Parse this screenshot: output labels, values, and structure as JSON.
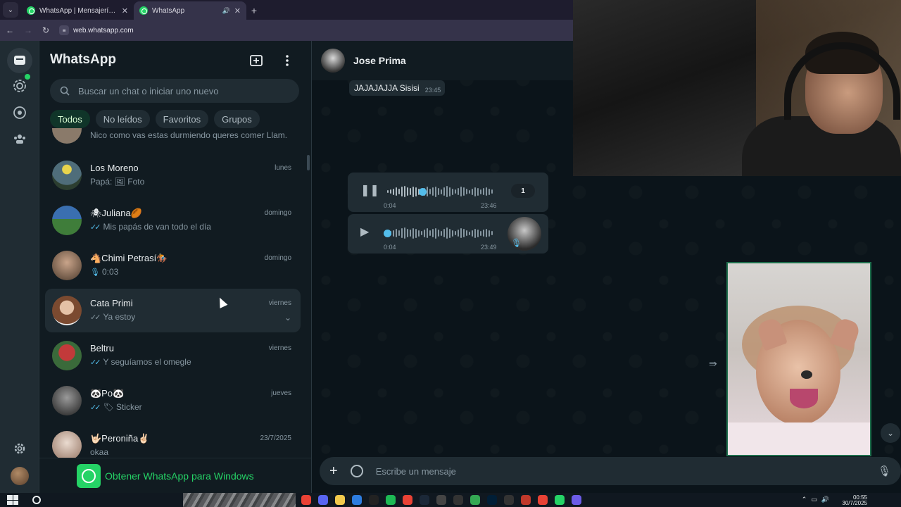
{
  "browser": {
    "tabs": [
      {
        "title": "WhatsApp | Mensajería y llamadas"
      },
      {
        "title": "WhatsApp"
      }
    ],
    "url": "web.whatsapp.com"
  },
  "sidebar": {
    "title": "WhatsApp",
    "search_placeholder": "Buscar un chat o iniciar uno nuevo",
    "filters": [
      "Todos",
      "No leídos",
      "Favoritos",
      "Grupos"
    ],
    "active_filter": "Todos",
    "chats": [
      {
        "name": "",
        "time": "",
        "preview": "Nico como vas estas durmiendo queres comer Llam..."
      },
      {
        "name": "Los Moreno",
        "time": "lunes",
        "preview": "Papá: 🖼 Foto"
      },
      {
        "name": "🕷Juliana🏉",
        "time": "domingo",
        "preview": "Mis papás de van todo el día",
        "ticks": true
      },
      {
        "name": "🐴Chimi Petrasí🏇",
        "time": "domingo",
        "preview": "0:03",
        "mic": true
      },
      {
        "name": "Cata Primi",
        "time": "viernes",
        "preview": "Ya estoy",
        "ticks": true
      },
      {
        "name": "Beltru",
        "time": "viernes",
        "preview": "Y seguíamos el omegle",
        "ticks": true
      },
      {
        "name": "🐼Po🐼",
        "time": "jueves",
        "preview": "🏷 Sticker",
        "ticks": true
      },
      {
        "name": "🤟🏻Peroniña✌🏻",
        "time": "23/7/2025",
        "preview": "okaa"
      }
    ],
    "promo": "Obtener WhatsApp para Windows"
  },
  "conversation": {
    "contact": "Jose Prima",
    "messages": [
      {
        "text": "JAJAJAJJA Sisisi",
        "time": "23:45"
      }
    ],
    "voice_notes": [
      {
        "duration": "0:04",
        "time": "23:46",
        "speed": "1",
        "progress": 0.33,
        "playing": true
      },
      {
        "duration": "0:04",
        "time": "23:49",
        "progress": 0.0,
        "playing": false
      }
    ],
    "composer_placeholder": "Escribe un mensaje"
  },
  "taskbar": {
    "time": "00:55",
    "date": "30/7/2025"
  },
  "colors": {
    "accent": "#25d366",
    "panel": "#111b21",
    "bubble": "#202c33",
    "blue_tick": "#53bdeb"
  }
}
